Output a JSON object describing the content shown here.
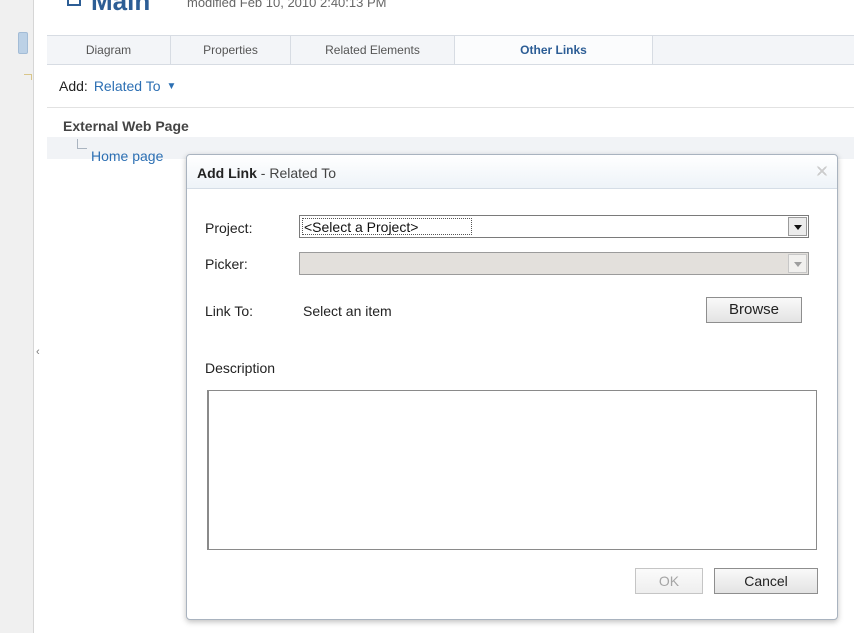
{
  "page": {
    "title_name": "Main",
    "modified_text": "modified Feb 10, 2010 2:40:13 PM"
  },
  "tabs": [
    {
      "label": "Diagram",
      "active": false
    },
    {
      "label": "Properties",
      "active": false
    },
    {
      "label": "Related Elements",
      "active": false
    },
    {
      "label": "Other Links",
      "active": true
    }
  ],
  "add_bar": {
    "label": "Add:",
    "link_text": "Related To"
  },
  "links": {
    "section_title": "External Web Page",
    "items": [
      "Home page"
    ]
  },
  "dialog": {
    "title_bold": "Add Link",
    "title_rest": " - Related To",
    "project_label": "Project:",
    "project_value": "<Select a Project>",
    "picker_label": "Picker:",
    "picker_value": "",
    "link_to_label": "Link To:",
    "link_to_value": "Select an item",
    "browse_label": "Browse",
    "description_label": "Description",
    "description_value": "",
    "ok_label": "OK",
    "cancel_label": "Cancel"
  },
  "icons": {
    "close": "close-icon",
    "dropdown": "caret-down-icon",
    "collapse": "chevron-left-icon"
  },
  "colors": {
    "link": "#2c6fb3",
    "title": "#2c5d95",
    "disabled_field": "#e3e0dc"
  }
}
